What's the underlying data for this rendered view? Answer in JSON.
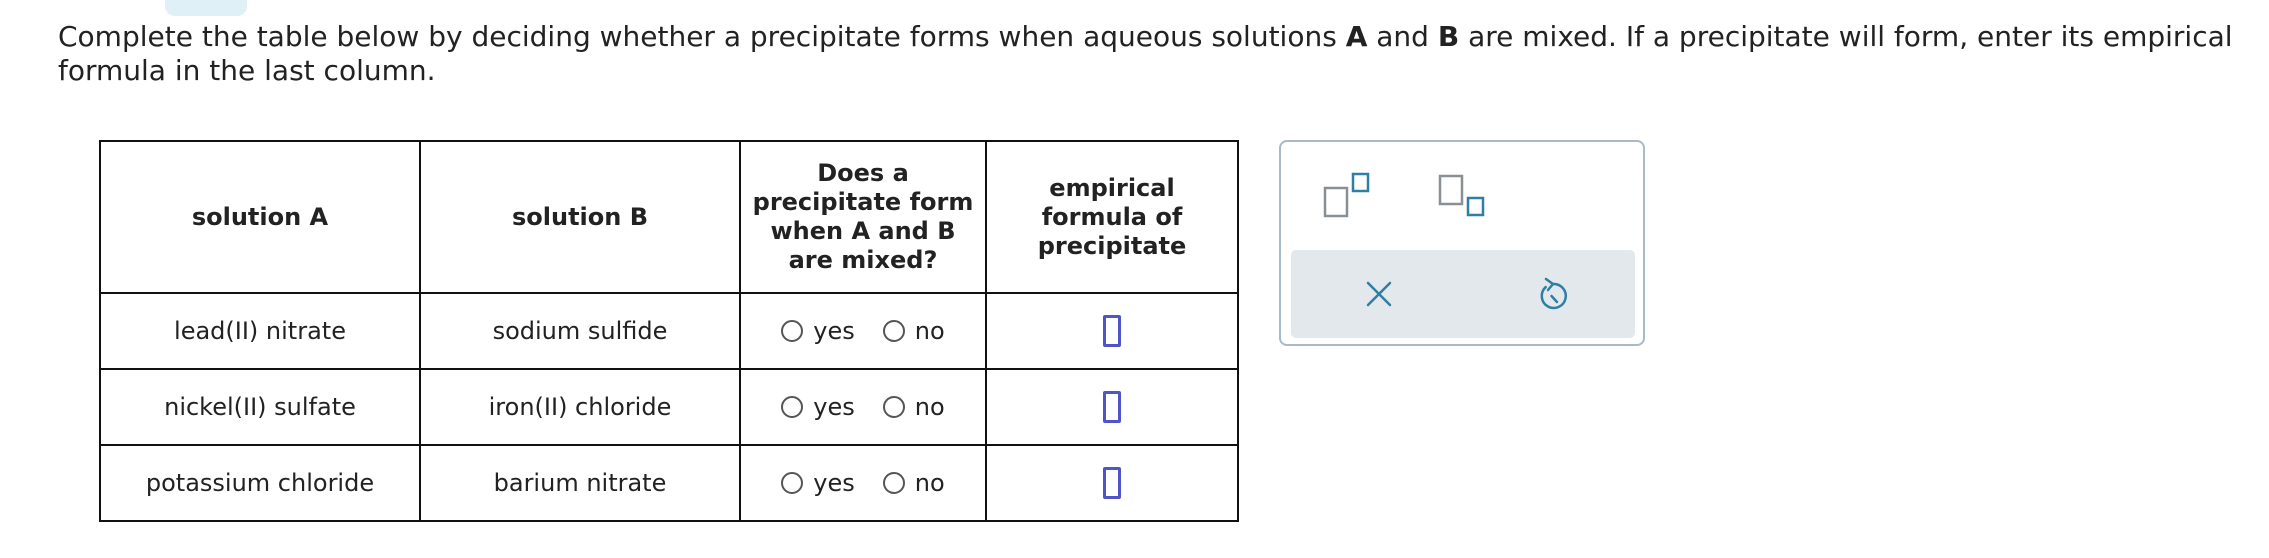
{
  "instructions": {
    "part1": "Complete the table below by deciding whether a precipitate forms when aqueous solutions ",
    "bold_a": "A",
    "part2": " and ",
    "bold_b": "B",
    "part3": " are mixed. If a precipitate will form, enter its empirical formula in the last column."
  },
  "table": {
    "headers": {
      "solution_a": "solution A",
      "solution_b": "solution B",
      "precipitate_question": "Does a precipitate form when A and B are mixed?",
      "empirical_formula": "empirical formula of precipitate"
    },
    "rows": [
      {
        "solution_a": "lead(II) nitrate",
        "solution_b": "sodium sulfide",
        "yes_label": "yes",
        "no_label": "no",
        "formula": ""
      },
      {
        "solution_a": "nickel(II) sulfate",
        "solution_b": "iron(II) chloride",
        "yes_label": "yes",
        "no_label": "no",
        "formula": ""
      },
      {
        "solution_a": "potassium chloride",
        "solution_b": "barium nitrate",
        "yes_label": "yes",
        "no_label": "no",
        "formula": ""
      }
    ]
  },
  "palette": {
    "buttons": [
      "superscript-button",
      "subscript-button",
      "clear-button",
      "undo-button"
    ]
  },
  "colors": {
    "formula_box_border": "#4f55c9",
    "palette_border": "#a8b9c9",
    "palette_action_bar": "#e2e8ec",
    "palette_icon": "#2e7fa3",
    "top_tab": "#dff0f7"
  }
}
